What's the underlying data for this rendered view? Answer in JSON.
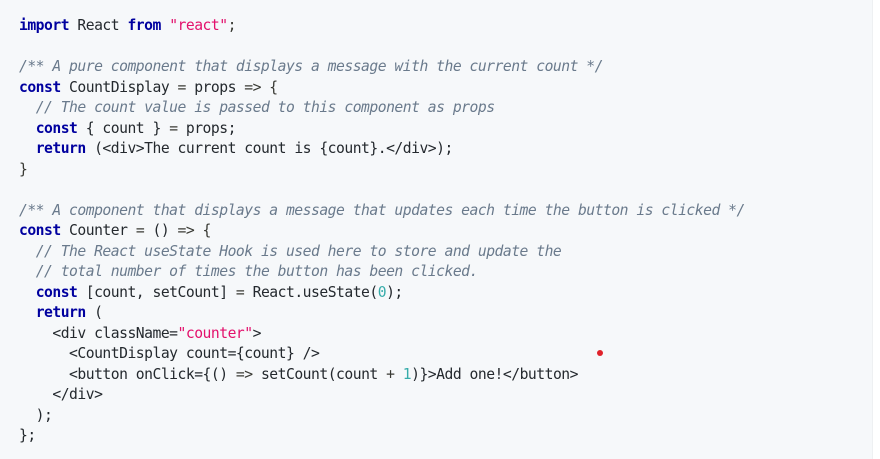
{
  "code": {
    "language": "javascript",
    "lines": [
      [
        {
          "t": "import",
          "c": "kw"
        },
        {
          "t": " React ",
          "c": "plain"
        },
        {
          "t": "from",
          "c": "kw"
        },
        {
          "t": " ",
          "c": "plain"
        },
        {
          "t": "\"react\"",
          "c": "str"
        },
        {
          "t": ";",
          "c": "pun"
        }
      ],
      [],
      [
        {
          "t": "/** A pure component that displays a message with the current count */",
          "c": "cm"
        }
      ],
      [
        {
          "t": "const",
          "c": "kw"
        },
        {
          "t": " CountDisplay ",
          "c": "plain"
        },
        {
          "t": "=",
          "c": "op"
        },
        {
          "t": " props ",
          "c": "plain"
        },
        {
          "t": "=>",
          "c": "op"
        },
        {
          "t": " {",
          "c": "pun"
        }
      ],
      [
        {
          "t": "  ",
          "c": "plain"
        },
        {
          "t": "// The count value is passed to this component as props",
          "c": "cm"
        }
      ],
      [
        {
          "t": "  ",
          "c": "plain"
        },
        {
          "t": "const",
          "c": "kw"
        },
        {
          "t": " { count } ",
          "c": "plain"
        },
        {
          "t": "=",
          "c": "op"
        },
        {
          "t": " props;",
          "c": "plain"
        }
      ],
      [
        {
          "t": "  ",
          "c": "plain"
        },
        {
          "t": "return",
          "c": "kw"
        },
        {
          "t": " (<div>The current count is {count}.</div>);",
          "c": "plain"
        }
      ],
      [
        {
          "t": "}",
          "c": "pun"
        }
      ],
      [],
      [
        {
          "t": "/** A component that displays a message that updates each time the button is clicked */",
          "c": "cm"
        }
      ],
      [
        {
          "t": "const",
          "c": "kw"
        },
        {
          "t": " Counter ",
          "c": "plain"
        },
        {
          "t": "=",
          "c": "op"
        },
        {
          "t": " () ",
          "c": "plain"
        },
        {
          "t": "=>",
          "c": "op"
        },
        {
          "t": " {",
          "c": "pun"
        }
      ],
      [
        {
          "t": "  ",
          "c": "plain"
        },
        {
          "t": "// The React useState Hook is used here to store and update the",
          "c": "cm"
        }
      ],
      [
        {
          "t": "  ",
          "c": "plain"
        },
        {
          "t": "// total number of times the button has been clicked.",
          "c": "cm"
        }
      ],
      [
        {
          "t": "  ",
          "c": "plain"
        },
        {
          "t": "const",
          "c": "kw"
        },
        {
          "t": " [count, setCount] ",
          "c": "plain"
        },
        {
          "t": "=",
          "c": "op"
        },
        {
          "t": " React.useState(",
          "c": "plain"
        },
        {
          "t": "0",
          "c": "num"
        },
        {
          "t": ");",
          "c": "plain"
        }
      ],
      [
        {
          "t": "  ",
          "c": "plain"
        },
        {
          "t": "return",
          "c": "kw"
        },
        {
          "t": " (",
          "c": "plain"
        }
      ],
      [
        {
          "t": "    <div className=",
          "c": "plain"
        },
        {
          "t": "\"counter\"",
          "c": "str"
        },
        {
          "t": ">",
          "c": "plain"
        }
      ],
      [
        {
          "t": "      <CountDisplay count={count} />",
          "c": "plain"
        }
      ],
      [
        {
          "t": "      <button onClick={() ",
          "c": "plain"
        },
        {
          "t": "=>",
          "c": "op"
        },
        {
          "t": " setCount(count ",
          "c": "plain"
        },
        {
          "t": "+",
          "c": "op"
        },
        {
          "t": " ",
          "c": "plain"
        },
        {
          "t": "1",
          "c": "num"
        },
        {
          "t": ")}>Add one!</button>",
          "c": "plain"
        }
      ],
      [
        {
          "t": "    </div>",
          "c": "plain"
        }
      ],
      [
        {
          "t": "  );",
          "c": "plain"
        }
      ],
      [
        {
          "t": "};",
          "c": "plain"
        }
      ]
    ]
  },
  "colors": {
    "background": "#f6f8fa",
    "keyword": "#00009f",
    "string": "#e3116c",
    "comment": "#6a7a8c",
    "number": "#36acaa",
    "marker": "#e0222a"
  }
}
